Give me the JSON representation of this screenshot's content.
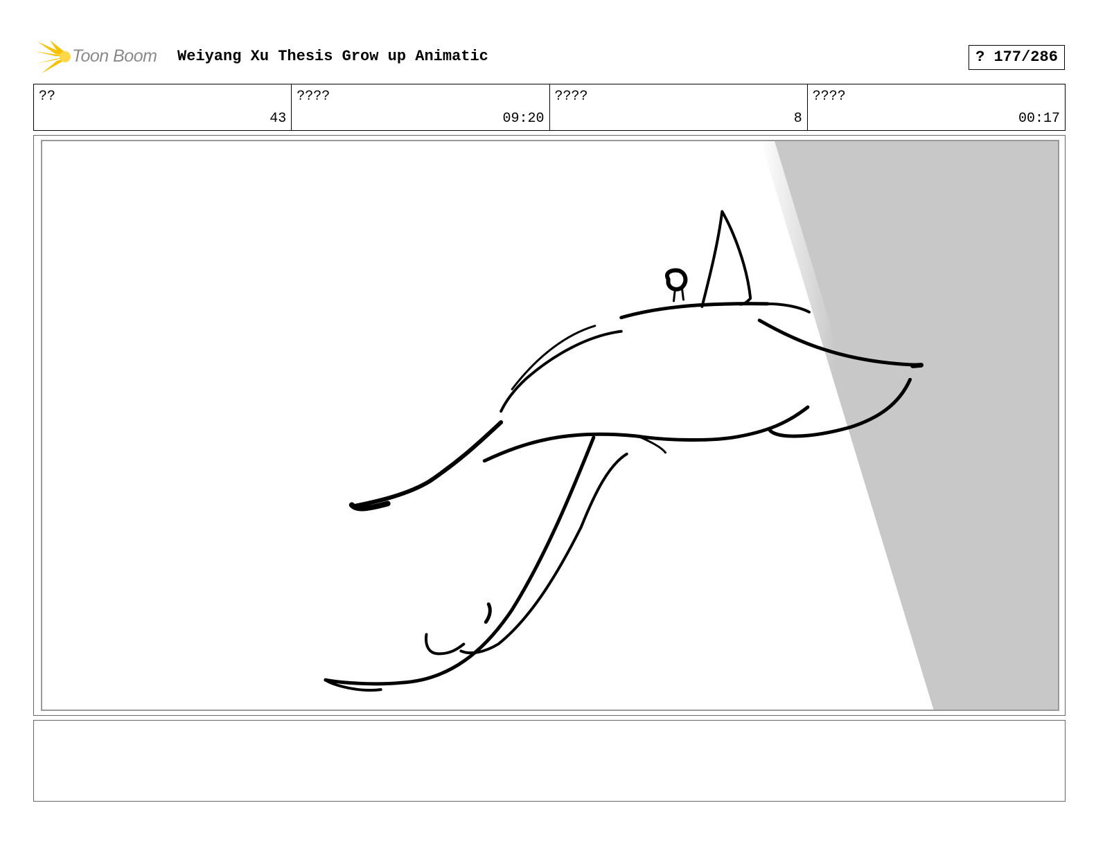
{
  "header": {
    "logo_text": "Toon Boom",
    "title": "Weiyang Xu Thesis Grow up Animatic",
    "page_counter": "? 177/286"
  },
  "info": [
    {
      "label": "??",
      "value": "43"
    },
    {
      "label": "????",
      "value": "09:20"
    },
    {
      "label": "????",
      "value": "8"
    },
    {
      "label": "????",
      "value": "00:17"
    }
  ],
  "panel": {
    "icons": [
      "toon-boom-logo-icon",
      "manta-ray-sketch-icon"
    ],
    "shadow_color": "#c8c8c8",
    "stroke_color": "#000000",
    "logo_color": "#f6c200"
  },
  "notes": {
    "text": ""
  }
}
